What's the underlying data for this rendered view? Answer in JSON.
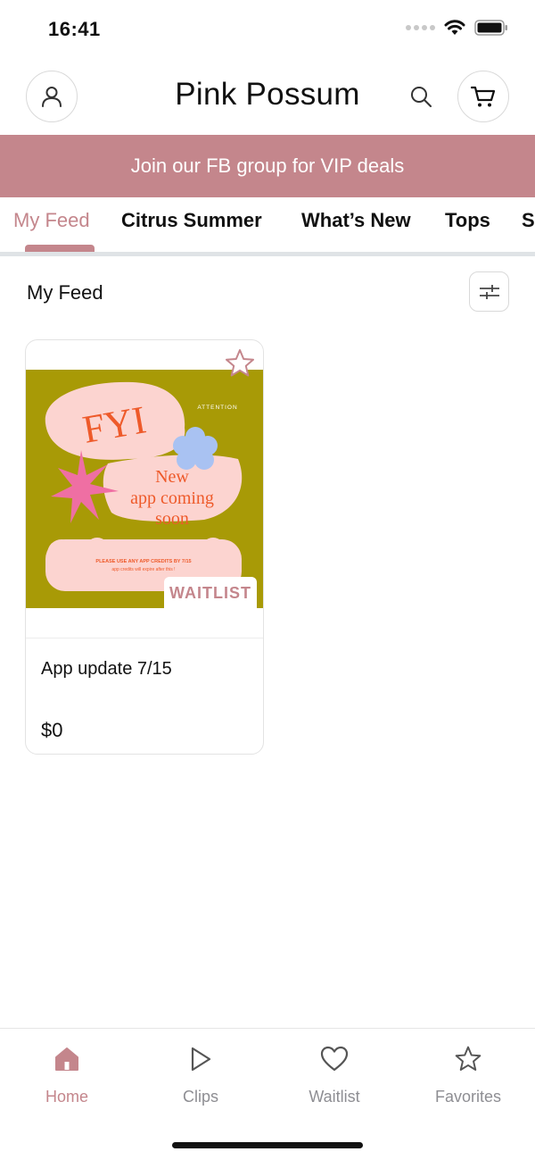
{
  "status_bar": {
    "time": "16:41"
  },
  "header": {
    "brand": "Pink Possum",
    "icons": [
      "account-icon",
      "search-icon",
      "cart-icon"
    ]
  },
  "promo": {
    "text": "Join our FB group for VIP deals",
    "background": "#c4868c"
  },
  "tabs": [
    {
      "label": "My Feed",
      "active": true
    },
    {
      "label": "Citrus Summer",
      "active": false
    },
    {
      "label": "What’s New",
      "active": false
    },
    {
      "label": "Tops",
      "active": false
    },
    {
      "label": "S",
      "active": false
    }
  ],
  "feed": {
    "title": "My Feed",
    "filter_icon": "sliders-icon",
    "products": [
      {
        "name": "App update 7/15",
        "price": "$0",
        "badge": "WAITLIST",
        "image_text": {
          "attention": "ATTENTION",
          "headline": "FYI",
          "line1": "New",
          "line2": "app coming",
          "line3": "soon",
          "note1": "PLEASE USE ANY APP CREDITS BY 7/15",
          "note2": "app credits will expire after this !"
        }
      }
    ]
  },
  "bottom_nav": [
    {
      "label": "Home",
      "icon": "home-icon",
      "active": true
    },
    {
      "label": "Clips",
      "icon": "play-icon",
      "active": false
    },
    {
      "label": "Waitlist",
      "icon": "heart-icon",
      "active": false
    },
    {
      "label": "Favorites",
      "icon": "star-icon",
      "active": false
    }
  ],
  "colors": {
    "accent": "#c4868c",
    "image_background": "#a89a06",
    "image_shape": "#fcd4d0",
    "image_text": "#ee5a2a"
  }
}
